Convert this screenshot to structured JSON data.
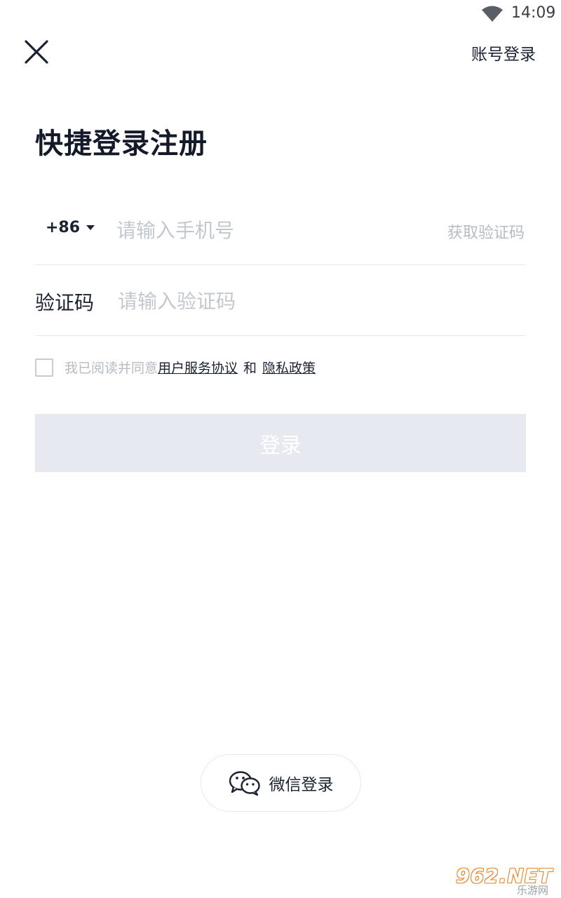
{
  "status_bar": {
    "time": "14:09"
  },
  "header": {
    "account_login": "账号登录"
  },
  "title": "快捷登录注册",
  "phone": {
    "country_code": "+86",
    "placeholder": "请输入手机号",
    "get_code": "获取验证码"
  },
  "code": {
    "label": "验证码",
    "placeholder": "请输入验证码"
  },
  "agreement": {
    "prefix": "我已阅读并同意",
    "terms": "用户服务协议",
    "and": "和",
    "privacy": "隐私政策"
  },
  "login_button": "登录",
  "wechat_login": "微信登录",
  "watermark": {
    "main": "962.NET",
    "sub": "乐游网"
  },
  "colors": {
    "text_primary": "#1a2233",
    "placeholder": "#c3c8d0",
    "button_disabled_bg": "#e6e9ef",
    "divider": "#e6e8ec"
  }
}
